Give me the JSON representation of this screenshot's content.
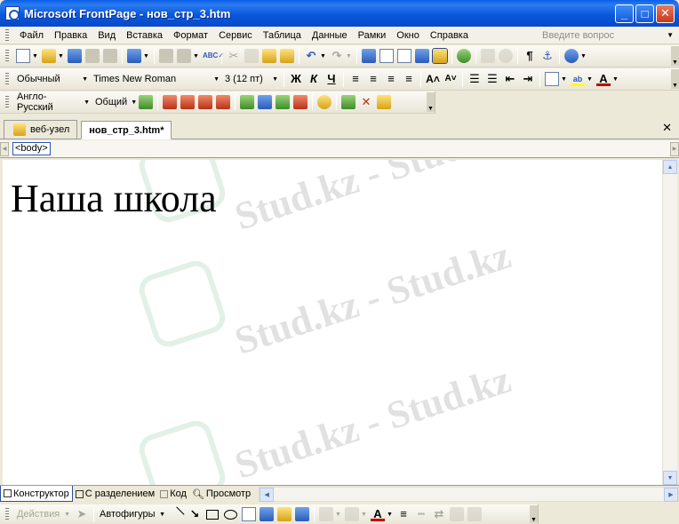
{
  "window": {
    "title": "Microsoft FrontPage - нов_стр_3.htm",
    "minimize": "_",
    "maximize": "□",
    "close": "✕"
  },
  "menu": {
    "items": [
      "Файл",
      "Правка",
      "Вид",
      "Вставка",
      "Формат",
      "Сервис",
      "Таблица",
      "Данные",
      "Рамки",
      "Окно",
      "Справка"
    ],
    "help_placeholder": "Введите вопрос"
  },
  "toolbar_format": {
    "style": "Обычный",
    "font": "Times New Roman",
    "size": "3 (12 пт)",
    "bold": "Ж",
    "italic": "К",
    "underline": "Ч"
  },
  "toolbar_lang": {
    "language": "Англо-Русский",
    "category": "Общий"
  },
  "doc_tabs": {
    "tab1": "веб-узел",
    "tab2": "нов_стр_3.htm*",
    "close": "✕"
  },
  "tag_bar": {
    "tag": "<body>"
  },
  "editor": {
    "heading": "Наша школа"
  },
  "watermark": {
    "text": "Stud.kz - Stud.kz"
  },
  "view_tabs": {
    "design": "Конструктор",
    "split": "С разделением",
    "code": "Код",
    "preview": "Просмотр"
  },
  "draw_toolbar": {
    "actions": "Действия",
    "autoshapes": "Автофигуры"
  }
}
